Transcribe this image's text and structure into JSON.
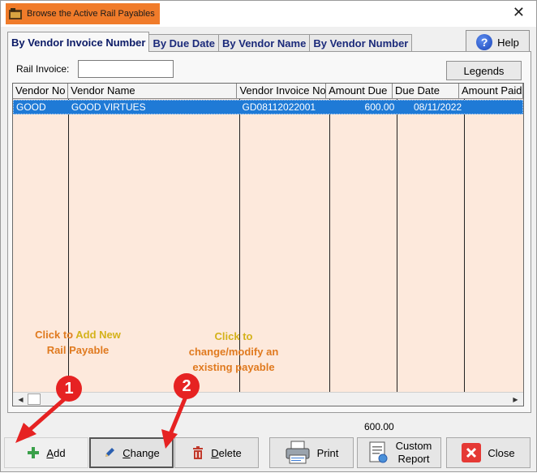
{
  "window": {
    "title": "Browse the Active Rail Payables",
    "close_glyph": "✕",
    "icon": "app-folder-icon"
  },
  "tabs": [
    {
      "label": "By Vendor Invoice Number",
      "active": true
    },
    {
      "label": "By Due Date",
      "active": false
    },
    {
      "label": "By Vendor Name",
      "active": false
    },
    {
      "label": "By Vendor Number",
      "active": false
    }
  ],
  "help": {
    "label": "Help",
    "icon": "help-icon",
    "glyph": "?"
  },
  "filter": {
    "label": "Rail Invoice:",
    "value": "",
    "placeholder": ""
  },
  "legends": {
    "label": "Legends"
  },
  "grid": {
    "columns": [
      "Vendor No",
      "Vendor Name",
      "Vendor Invoice No",
      "Amount Due",
      "Due Date",
      "Amount Paid"
    ],
    "rows": [
      {
        "vendor_no": "GOOD",
        "vendor_name": "GOOD VIRTUES",
        "invoice_no": "GD08112022001",
        "amount_due": "600.00",
        "due_date": "08/11/2022",
        "amount_paid": ""
      }
    ],
    "scroll_left": "◀",
    "scroll_right": "▶",
    "row_color": "#1f7ad6",
    "body_color": "#fde9dc"
  },
  "annotations": {
    "add": {
      "line1": "Click to",
      "line1b": " Add New",
      "line2": "Rail Payable"
    },
    "change": {
      "line1": "Click to",
      "line2": "change/modify an",
      "line3": "existing payable"
    },
    "badge1": "1",
    "badge2": "2"
  },
  "total": "600.00",
  "buttons": {
    "add": {
      "label": "Add",
      "underline": "A",
      "rest": "dd",
      "icon": "plus-icon"
    },
    "change": {
      "label": "Change",
      "underline": "C",
      "rest": "hange",
      "icon": "pencil-icon"
    },
    "delete": {
      "label": "Delete",
      "underline": "D",
      "rest": "elete",
      "icon": "trash-icon"
    },
    "print": {
      "label": "Print",
      "icon": "printer-icon"
    },
    "custom_report": {
      "line1": "Custom",
      "line2": "Report",
      "icon": "report-icon"
    },
    "close": {
      "label": "Close",
      "icon": "close-icon"
    }
  }
}
